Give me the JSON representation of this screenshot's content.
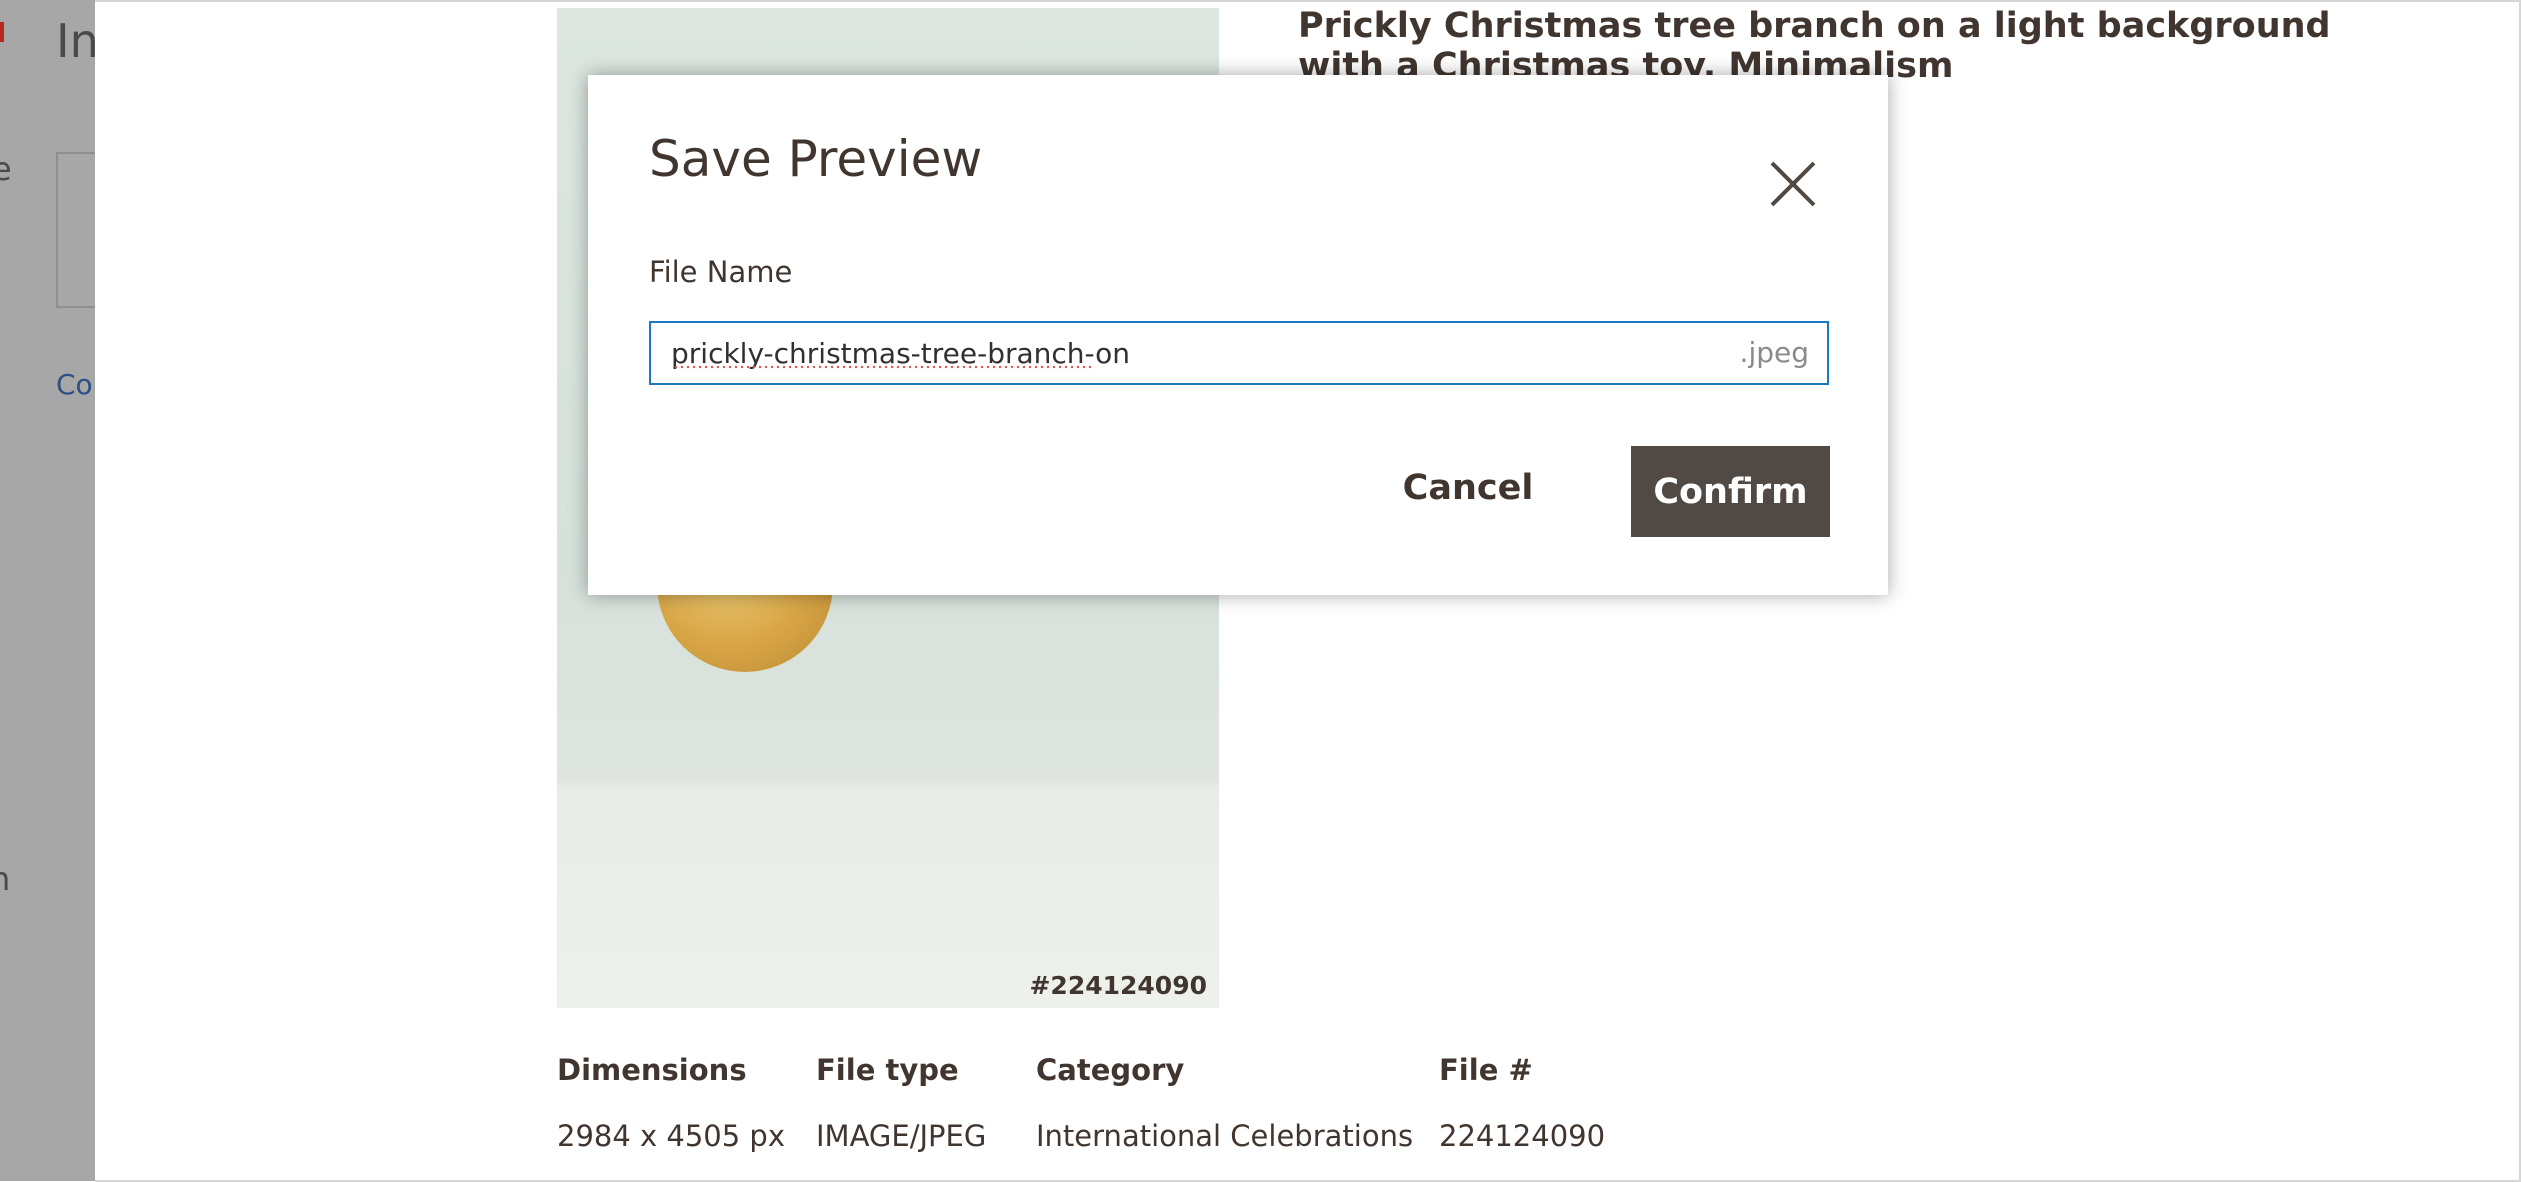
{
  "background_page": {
    "title_fragment": "In",
    "link_fragment": "Co"
  },
  "asset": {
    "title": "Prickly Christmas tree branch on a light background with a Christmas toy. Minimalism",
    "image_id_label": "#224124090",
    "meta": {
      "headers": [
        "Dimensions",
        "File type",
        "Category",
        "File #"
      ],
      "values": [
        "2984 x 4505 px",
        "IMAGE/JPEG",
        "International Celebrations",
        "224124090"
      ]
    }
  },
  "modal": {
    "title": "Save Preview",
    "close_icon": "close-icon",
    "field_label": "File Name",
    "file_name_value": "prickly-christmas-tree-branch-on",
    "file_extension": ".jpeg",
    "cancel_label": "Cancel",
    "confirm_label": "Confirm"
  },
  "colors": {
    "primary_button": "#514943",
    "input_focus_border": "#1979c3",
    "text": "#41362f"
  }
}
